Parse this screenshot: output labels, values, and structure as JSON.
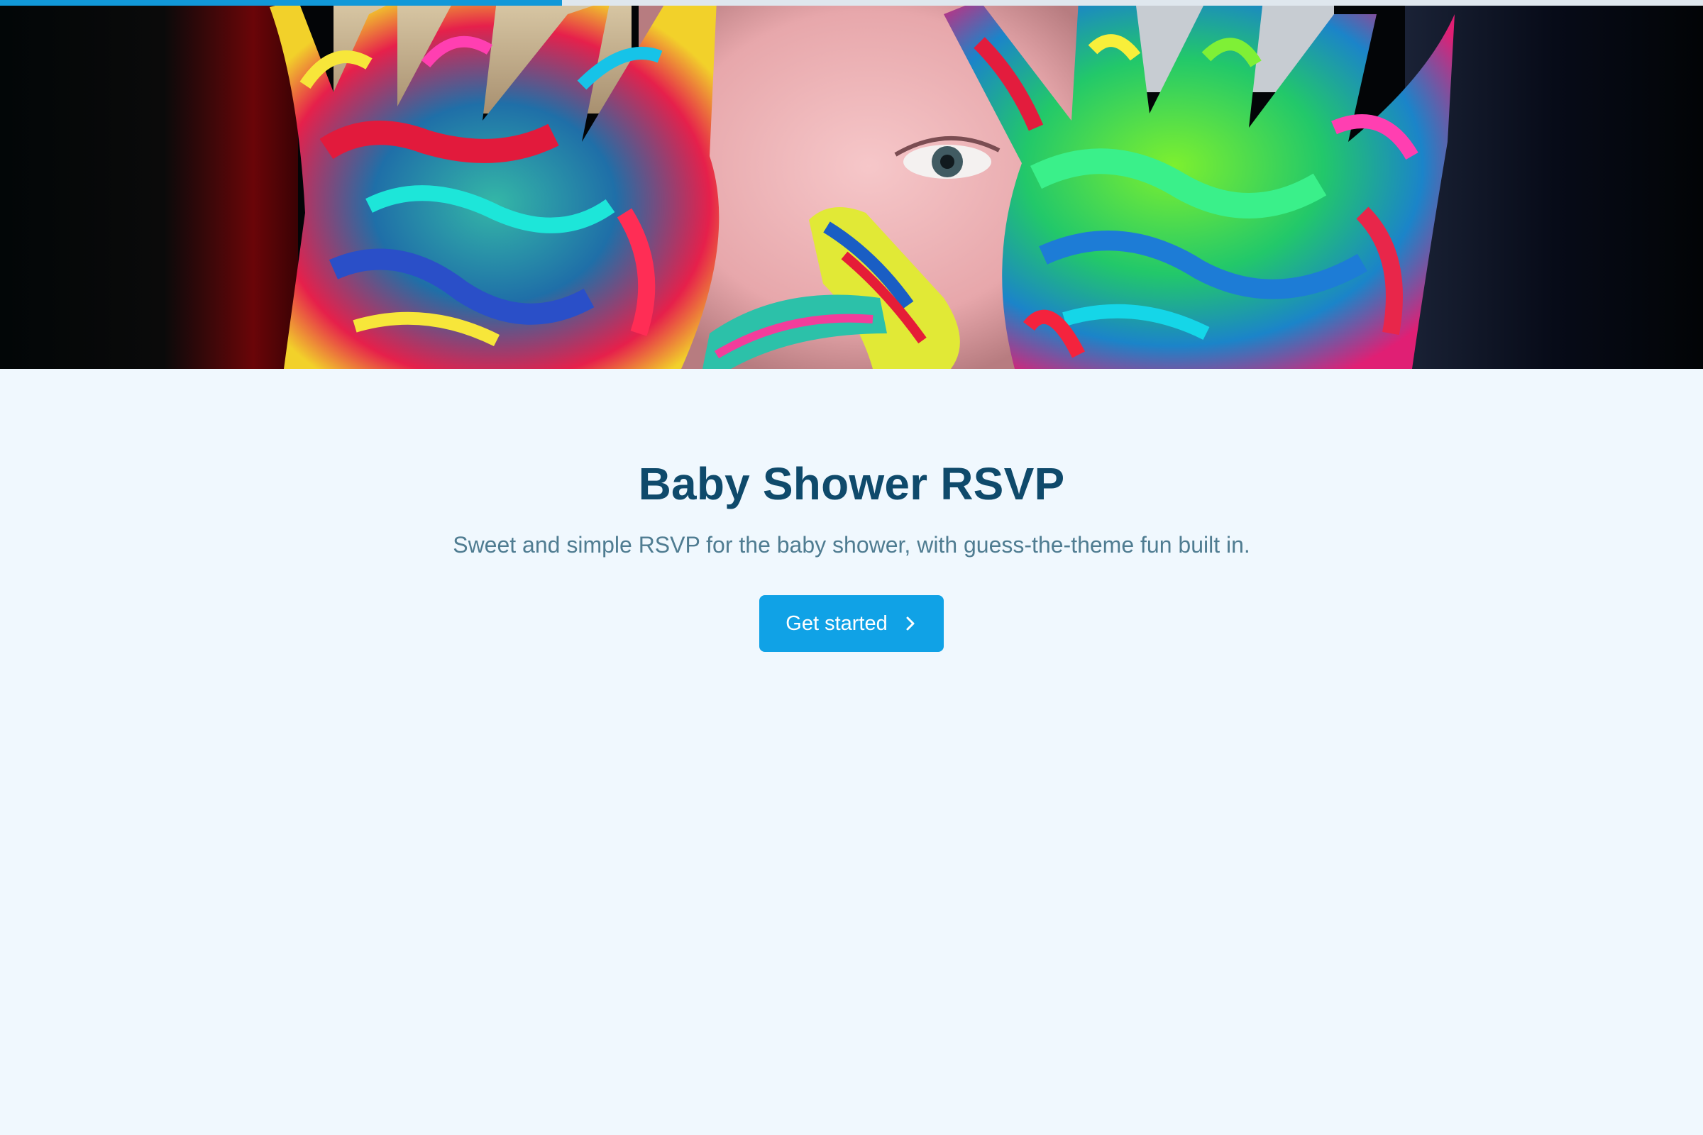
{
  "progress": {
    "fraction": 0.33
  },
  "hero": {
    "image_alt": "Child peeking through hands covered in colorful paint"
  },
  "page": {
    "title": "Baby Shower RSVP",
    "subtitle": "Sweet and simple RSVP for the baby shower, with guess-the-theme fun built in.",
    "cta_label": "Get started",
    "cta_icon": "chevron-right-icon"
  },
  "colors": {
    "background": "#f0f8fe",
    "accent": "#10a2e6",
    "progress": "#1198d8",
    "title": "#0f4a6b",
    "subtitle": "#4f7c91"
  }
}
